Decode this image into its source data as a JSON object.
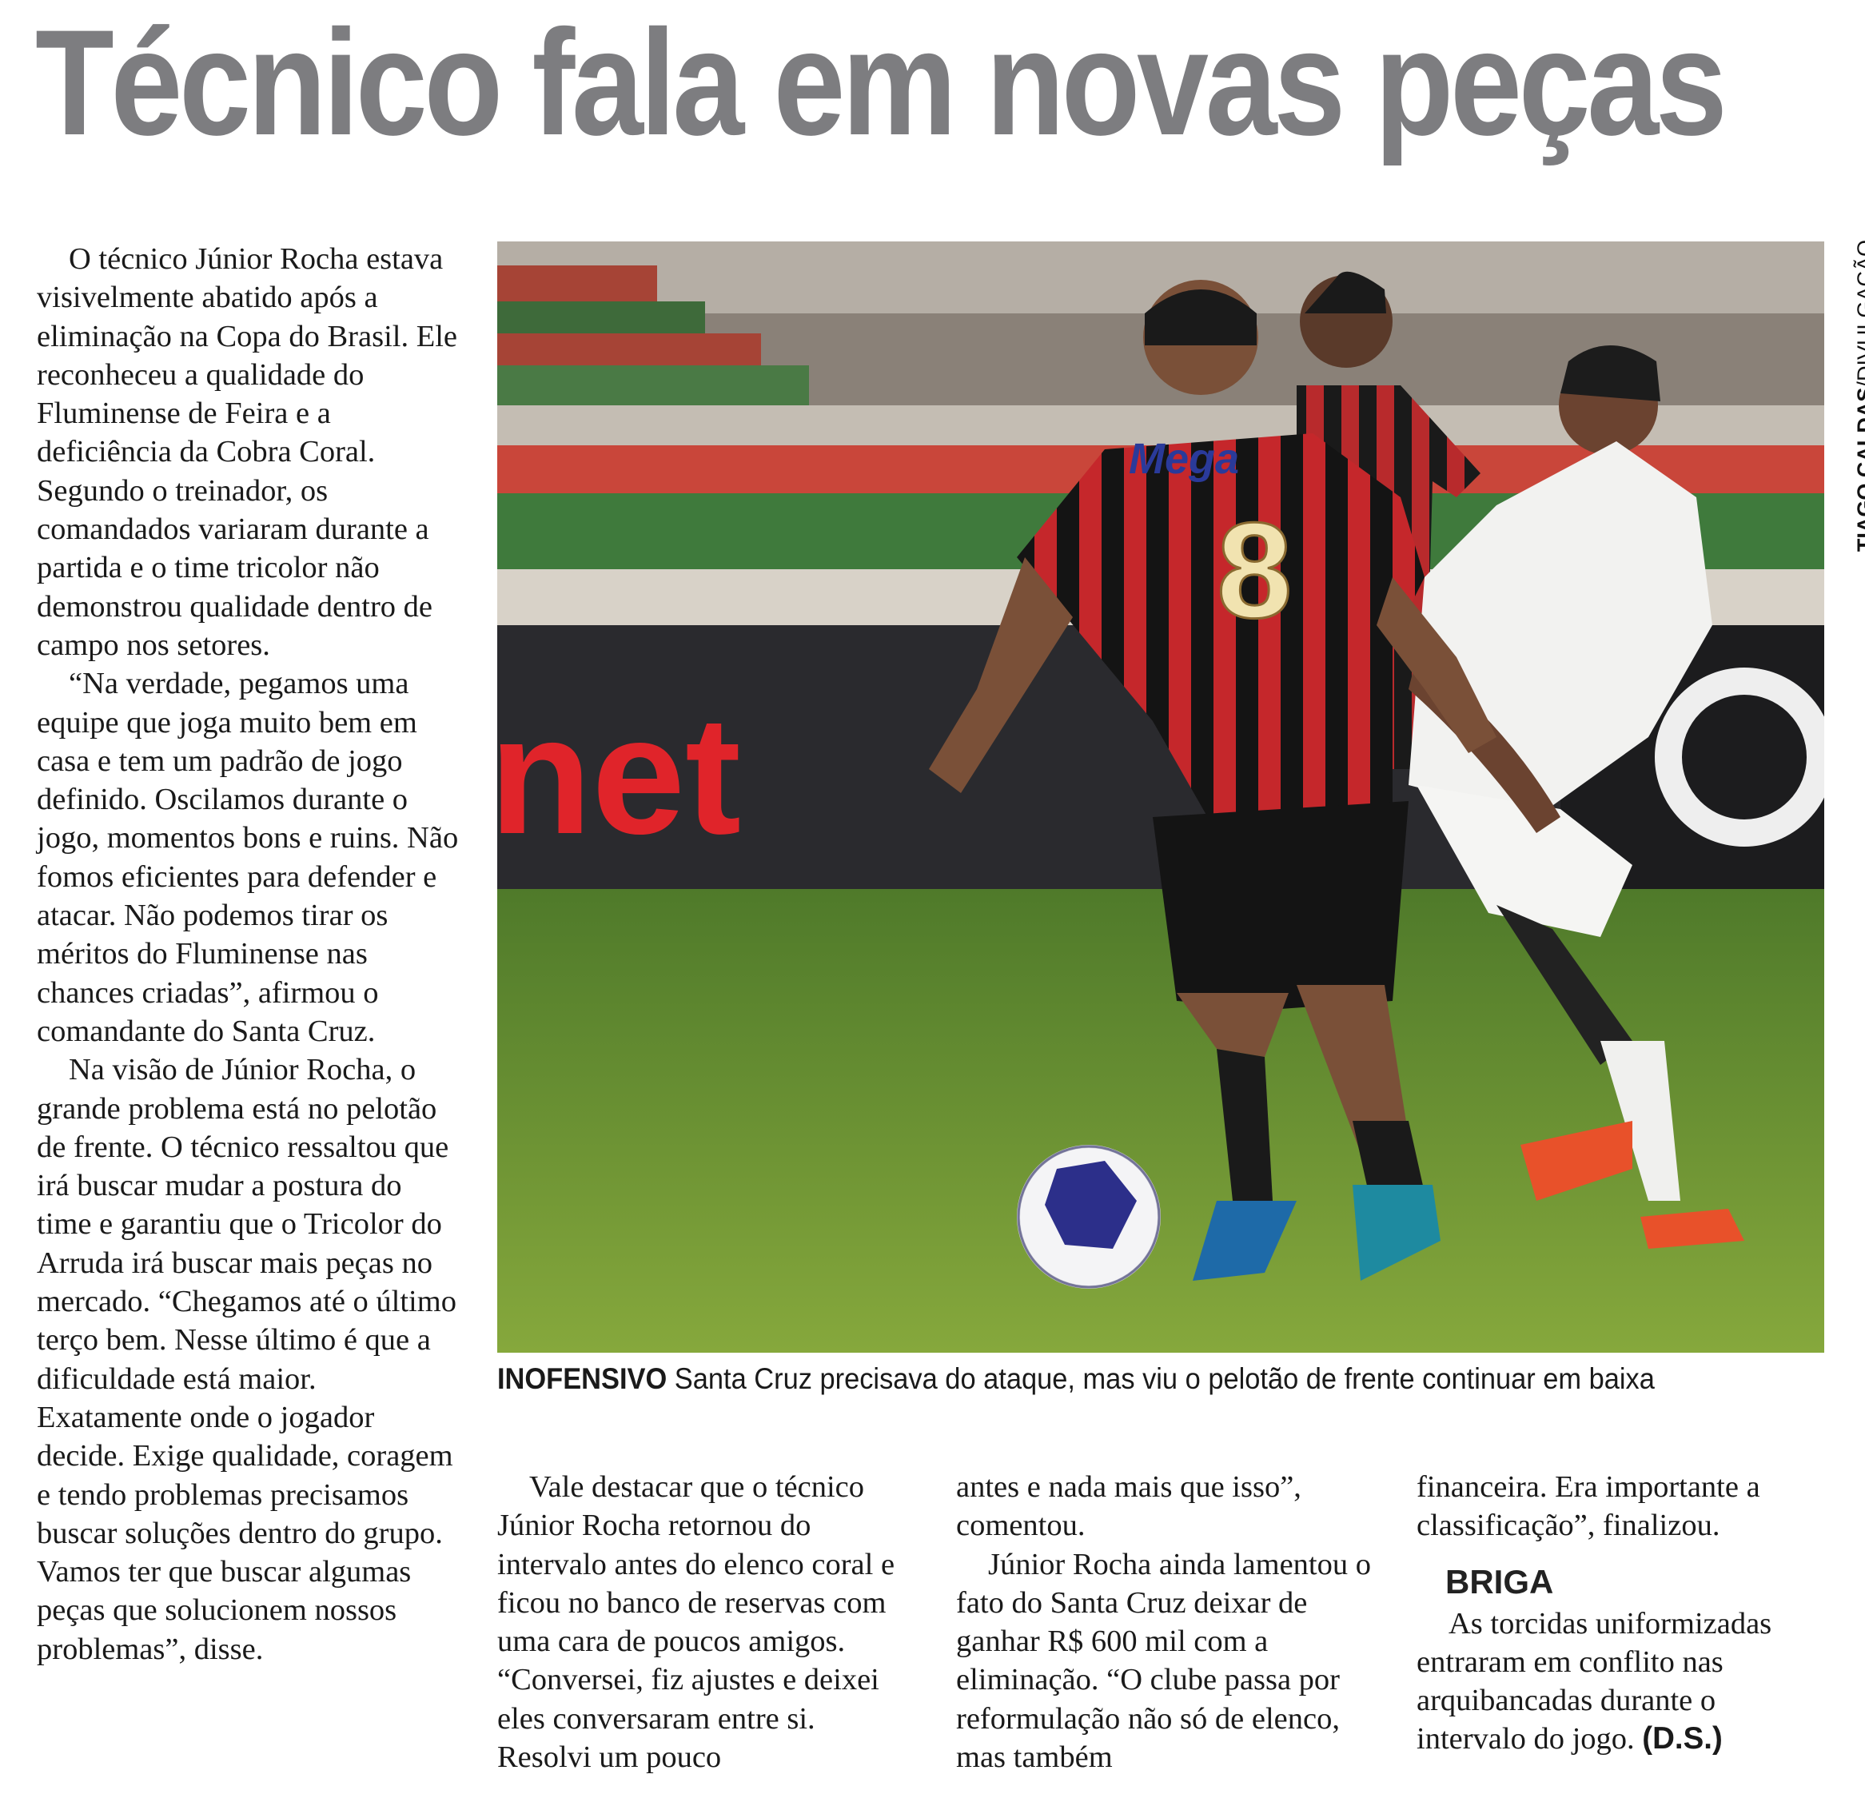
{
  "headline": "Técnico fala em novas peças",
  "photo": {
    "credit_name": "TIAGO CALDAS",
    "credit_sep": "/",
    "credit_source": "DIVULGAÇÃO",
    "board_text": "net",
    "shirt_sponsor": "Mega",
    "shirt_number": "8"
  },
  "caption": {
    "label": "INOFENSIVO",
    "text": " Santa Cruz precisava do ataque, mas viu o pelotão de frente continuar em baixa"
  },
  "article": {
    "col1": [
      "O técnico Júnior Rocha estava visivelmente abatido após a eliminação na Copa do Brasil. Ele reconheceu a qualidade do Fluminense de Feira e a deficiência da Cobra Coral. Segundo o treinador, os comandados variaram durante a partida e o time tricolor não demonstrou qualidade dentro de campo nos setores.",
      "“Na verdade, pegamos uma equipe que joga muito bem em casa e tem um padrão de jogo definido. Oscilamos durante o jogo, momentos bons e ruins. Não fomos eficientes para defender e atacar. Não podemos tirar os méritos do Fluminense nas chances criadas”, afirmou o comandante do Santa Cruz.",
      "Na visão de Júnior Rocha, o grande problema está no pelotão de frente. O técnico ressaltou que irá buscar mudar a postura do time e garantiu que o Tricolor do Arruda irá buscar mais peças no mercado. “Chegamos até o último terço bem. Nesse último é que a dificuldade está maior. Exatamente onde o jogador decide. Exige qualidade, coragem e tendo problemas precisamos buscar soluções dentro do grupo. Vamos ter que buscar algumas peças que solucionem nossos problemas”, disse."
    ],
    "col2": "Vale destacar que o técnico Júnior Rocha retornou do intervalo antes do elenco coral e ficou no banco de reservas com uma cara de poucos amigos. “Conversei, fiz ajustes e deixei eles conversaram entre si. Resolvi um pouco",
    "col3_a": "antes e nada mais que isso”, comentou.",
    "col3_b": "Júnior Rocha ainda lamentou o fato do Santa Cruz deixar de ganhar R$ 600 mil com a eliminação. “O clube passa por reformulação não só de elenco, mas também",
    "col4_a": "financeira. Era importante a classificação”, finalizou.",
    "subhead": "BRIGA",
    "col4_b": "As torcidas uniformizadas entraram em conflito nas arquibancadas durante o intervalo do jogo. ",
    "signature": "(D.S.)"
  }
}
